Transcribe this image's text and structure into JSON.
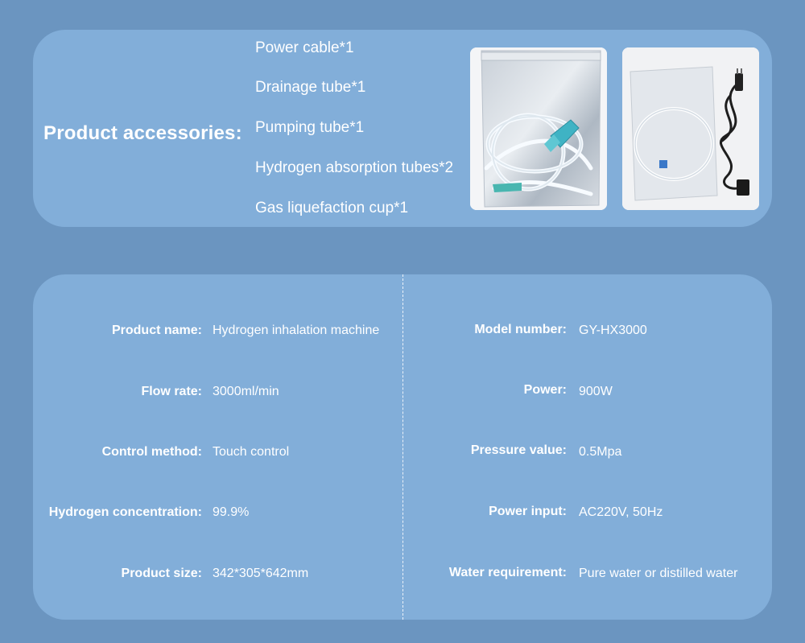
{
  "accessories": {
    "title": "Product accessories:",
    "items": [
      "Power cable*1",
      "Drainage tube*1",
      "Pumping tube*1",
      "Hydrogen absorption tubes*2",
      "Gas liquefaction cup*1"
    ]
  },
  "specs": {
    "left": [
      {
        "label": "Product name:",
        "value": "Hydrogen inhalation machine"
      },
      {
        "label": "Flow rate:",
        "value": "3000ml/min"
      },
      {
        "label": "Control method:",
        "value": "Touch control"
      },
      {
        "label": "Hydrogen concentration:",
        "value": "99.9%"
      },
      {
        "label": "Product size:",
        "value": "342*305*642mm"
      }
    ],
    "right": [
      {
        "label": "Model number:",
        "value": "GY-HX3000"
      },
      {
        "label": "Power:",
        "value": "900W"
      },
      {
        "label": "Pressure value:",
        "value": "0.5Mpa"
      },
      {
        "label": "Power input:",
        "value": "AC220V, 50Hz"
      },
      {
        "label": "Water requirement:",
        "value": "Pure water or distilled water"
      }
    ]
  },
  "colors": {
    "background": "#6b95c0",
    "card": "#82aed9",
    "text": "#ffffff"
  }
}
